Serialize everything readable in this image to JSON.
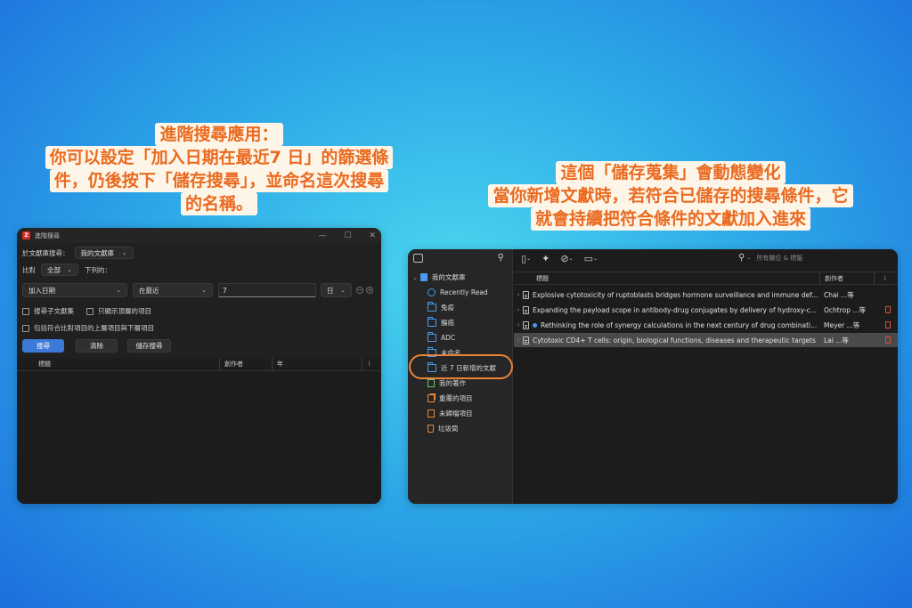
{
  "captions": {
    "left": {
      "lines": [
        "進階搜尋應用：",
        "你可以設定「加入日期在最近7 日」的篩選條",
        "件，仍後按下「儲存搜尋」，並命名這次搜尋",
        "的名稱。"
      ]
    },
    "right": {
      "lines": [
        "這個「儲存蒐集」會動態變化",
        "當你新增文獻時，若符合已儲存的搜尋條件，它",
        "就會持續把符合條件的文獻加入進來"
      ]
    }
  },
  "advanced_search": {
    "window_title": "進階搜尋",
    "app_icon_letter": "Z",
    "controls": {
      "minimize": "—",
      "maximize": "☐",
      "close": "✕"
    },
    "search_in_label": "於文獻庫搜尋：",
    "library_select": "我的文獻庫",
    "match_label": "比對",
    "match_select": "全部",
    "following_label": "下列的：",
    "condition": {
      "field": "加入日期",
      "operator": "在最近",
      "value": "7",
      "unit": "日"
    },
    "checkboxes": {
      "search_subcollections": "搜尋子文獻集",
      "top_level_only": "只顯示頂層的項目",
      "include_parent_child": "包括符合比對項目的上層項目與下層項目"
    },
    "buttons": {
      "search": "搜尋",
      "clear": "清除",
      "save_search": "儲存搜尋"
    },
    "columns": {
      "title": "標題",
      "creator": "創作者",
      "year": "年"
    }
  },
  "zotero": {
    "search_placeholder": "所有欄位 & 標籤",
    "library_name": "我的文獻庫",
    "collections": [
      {
        "label": "Recently Read",
        "icon": "clock-icon"
      },
      {
        "label": "兔疫",
        "icon": "folder-icon"
      },
      {
        "label": "腸癌",
        "icon": "folder-icon"
      },
      {
        "label": "ADC",
        "icon": "folder-icon"
      },
      {
        "label": "未命名",
        "icon": "saved-search-icon"
      },
      {
        "label": "近 7 日新增的文獻",
        "icon": "saved-search-icon"
      },
      {
        "label": "我的著作",
        "icon": "my-publications-icon"
      },
      {
        "label": "重覆的項目",
        "icon": "duplicate-icon"
      },
      {
        "label": "未歸檔項目",
        "icon": "unfiled-icon"
      },
      {
        "label": "垃圾筒",
        "icon": "trash-icon"
      }
    ],
    "columns": {
      "title": "標題",
      "creator": "創作者"
    },
    "items": [
      {
        "title": "Explosive cytotoxicity of ruptoblasts bridges hormone surveillance and immune def...",
        "creator": "Chai ...等",
        "has_pdf": false,
        "unread": false
      },
      {
        "title": "Expanding the payload scope in antibody-drug conjugates by delivery of hydroxy-c...",
        "creator": "Ochtrop ...等",
        "has_pdf": true,
        "unread": false
      },
      {
        "title": "Rethinking the role of synergy calculations in the next century of drug combinati...",
        "creator": "Meyer ...等",
        "has_pdf": true,
        "unread": true
      },
      {
        "title": "Cytotoxic CD4+ T cells: origin, biological functions, diseases and therapeutic targets",
        "creator": "Lai ...等",
        "has_pdf": true,
        "unread": false
      }
    ]
  },
  "colors": {
    "caption_text": "#ea6a20",
    "caption_bg": "#fdf6e8",
    "highlight_ellipse": "#e8833a",
    "primary_button": "#3d7ad8",
    "folder": "#4a9bf0",
    "pdf": "#e0533d"
  }
}
